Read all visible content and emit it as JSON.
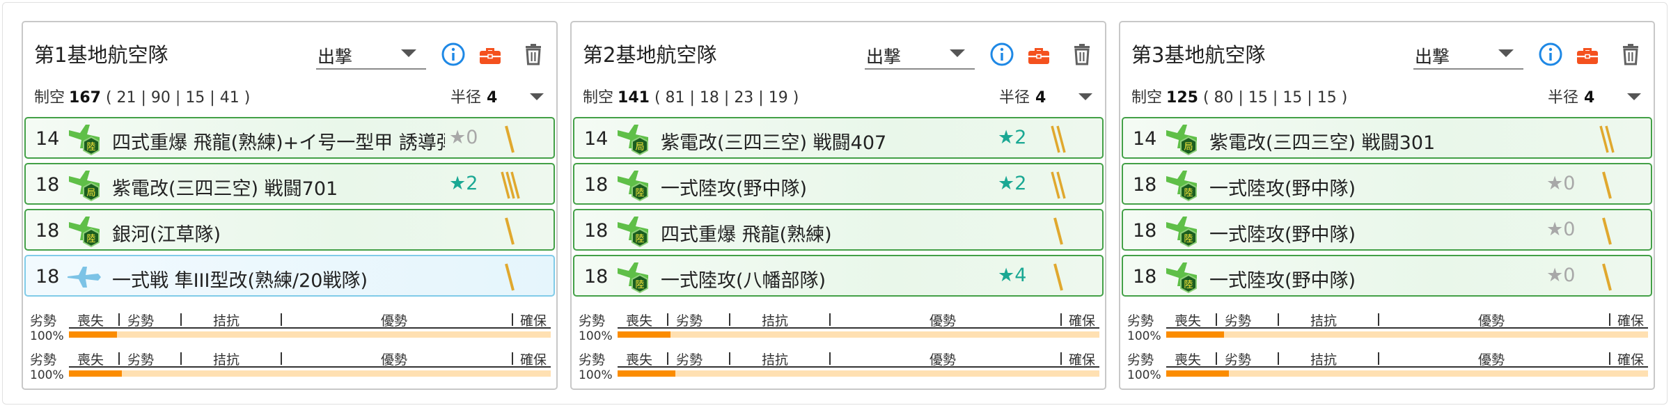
{
  "sortie_label": "出撃",
  "radius_label": "半径",
  "air_power_label": "制空",
  "gauge_labels": {
    "left": "劣勢",
    "right": "確保",
    "pct": "100%",
    "ticks": [
      "喪失",
      "劣勢",
      "拮抗",
      "優勢"
    ]
  },
  "colors": {
    "row_border": "#43a047",
    "row_border_blue": "#80cbe8",
    "star_teal": "#1aa893",
    "star_gray": "#a8a8a8",
    "bar_fill": "#fb8c00",
    "bar_track": "#ffe0b2",
    "info_icon": "#1e88e5",
    "kit_icon": "#f4511e"
  },
  "bases": [
    {
      "title": "第1基地航空隊",
      "sortie": "出撃",
      "air_power": "167",
      "breakdown": "( 21 | 90 | 15 | 41 )",
      "radius": "4",
      "gauges": [
        0.1,
        0.11
      ],
      "planes": [
        {
          "slot": "14",
          "name": "四式重爆 飛龍(熟練)+イ号一型甲 誘導弾",
          "star": "★0",
          "star_style": "gray",
          "icon": "land-bomber-icon",
          "proficiency": 1,
          "row_style": "green"
        },
        {
          "slot": "18",
          "name": "紫電改(三四三空) 戦闘701",
          "star": "★2",
          "star_style": "teal",
          "icon": "land-fighter-icon",
          "proficiency": 3,
          "row_style": "green"
        },
        {
          "slot": "18",
          "name": "銀河(江草隊)",
          "star": "",
          "star_style": "none",
          "icon": "land-bomber-icon",
          "proficiency": 1,
          "row_style": "green"
        },
        {
          "slot": "18",
          "name": "一式戦 隼III型改(熟練/20戦隊)",
          "star": "",
          "star_style": "none",
          "icon": "army-fighter-icon",
          "proficiency": 1,
          "row_style": "blue"
        }
      ]
    },
    {
      "title": "第2基地航空隊",
      "sortie": "出撃",
      "air_power": "141",
      "breakdown": "( 81 | 18 | 23 | 19 )",
      "radius": "4",
      "gauges": [
        0.11,
        0.12
      ],
      "planes": [
        {
          "slot": "14",
          "name": "紫電改(三四三空) 戦闘407",
          "star": "★2",
          "star_style": "teal",
          "icon": "land-fighter-icon",
          "proficiency": 2,
          "row_style": "green"
        },
        {
          "slot": "18",
          "name": "一式陸攻(野中隊)",
          "star": "★2",
          "star_style": "teal",
          "icon": "land-bomber-icon",
          "proficiency": 2,
          "row_style": "green"
        },
        {
          "slot": "18",
          "name": "四式重爆 飛龍(熟練)",
          "star": "",
          "star_style": "none",
          "icon": "land-bomber-icon",
          "proficiency": 1,
          "row_style": "green"
        },
        {
          "slot": "18",
          "name": "一式陸攻(八幡部隊)",
          "star": "★4",
          "star_style": "teal",
          "icon": "land-bomber-icon",
          "proficiency": 1,
          "row_style": "green"
        }
      ]
    },
    {
      "title": "第3基地航空隊",
      "sortie": "出撃",
      "air_power": "125",
      "breakdown": "( 80 | 15 | 15 | 15 )",
      "radius": "4",
      "gauges": [
        0.12,
        0.13
      ],
      "planes": [
        {
          "slot": "14",
          "name": "紫電改(三四三空) 戦闘301",
          "star": "",
          "star_style": "none",
          "icon": "land-fighter-icon",
          "proficiency": 2,
          "row_style": "green"
        },
        {
          "slot": "18",
          "name": "一式陸攻(野中隊)",
          "star": "★0",
          "star_style": "gray",
          "icon": "land-bomber-icon",
          "proficiency": 1,
          "row_style": "green"
        },
        {
          "slot": "18",
          "name": "一式陸攻(野中隊)",
          "star": "★0",
          "star_style": "gray",
          "icon": "land-bomber-icon",
          "proficiency": 1,
          "row_style": "green"
        },
        {
          "slot": "18",
          "name": "一式陸攻(野中隊)",
          "star": "★0",
          "star_style": "gray",
          "icon": "land-bomber-icon",
          "proficiency": 1,
          "row_style": "green"
        }
      ]
    }
  ]
}
